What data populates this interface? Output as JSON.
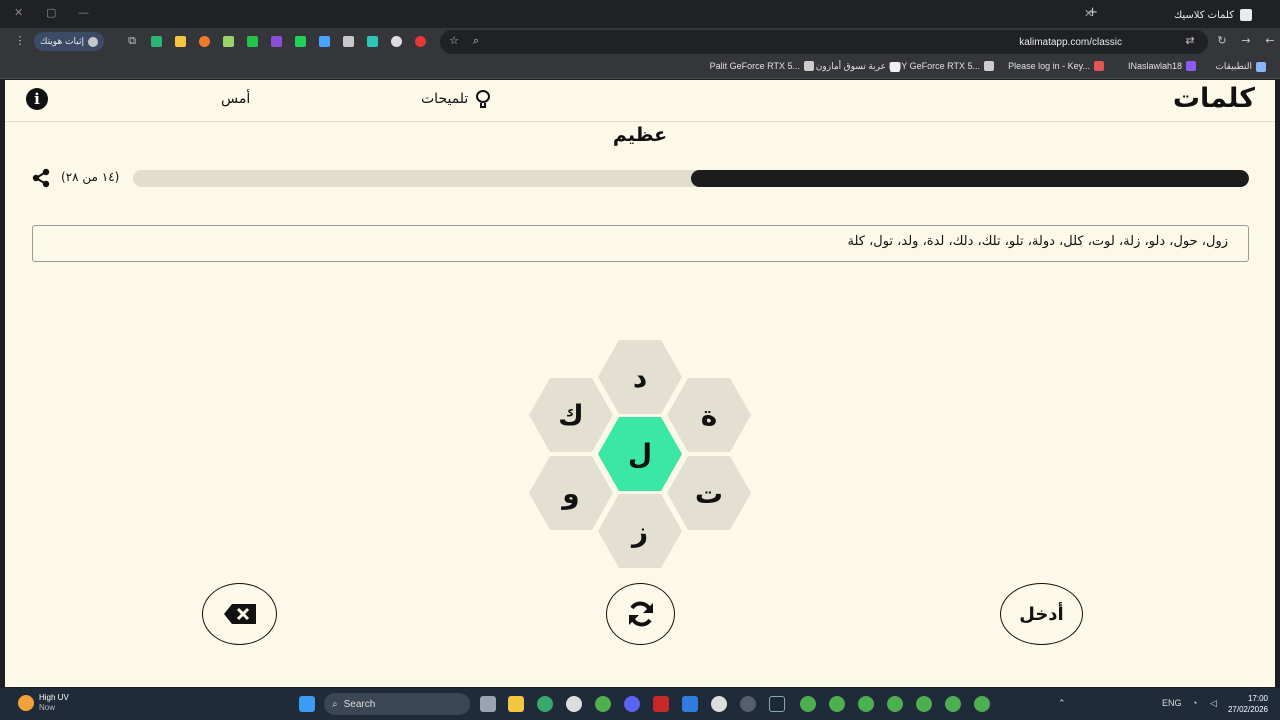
{
  "browser": {
    "tab_title": "كلمات كلاسيك",
    "url": "kalimatapp.com/classic",
    "profile_label": "إثبات هويتك",
    "bookmarks": [
      {
        "label": "التطبيقات",
        "color": "#8ab4f8"
      },
      {
        "label": "INaslawlah18",
        "color": "#8b5cf6"
      },
      {
        "label": "Please log in - Key...",
        "color": "#e25555"
      },
      {
        "label": "PNY GeForce RTX 5...",
        "color": "#cccccc"
      },
      {
        "label": "عربة تسوق أمازون",
        "color": "#f0f0f0"
      },
      {
        "label": "Palit GeForce RTX 5...",
        "color": "#cccccc"
      }
    ]
  },
  "app": {
    "logo": "كلمات",
    "hints_label": "تلميحات",
    "yesterday_label": "أمس",
    "info_icon": "i",
    "rank": "عظيم",
    "count_label": "(١٤ من ٢٨)",
    "progress": 0.5,
    "found_words": "زول، حول، دلو، زلة، لوت، كلل، دولة، تلو، تلك، دلك، لدة، ولد، تول، كلة",
    "letters": {
      "center": "ل",
      "top": "د",
      "upper_left": "ك",
      "upper_right": "ة",
      "lower_left": "و",
      "lower_right": "ت",
      "bottom": "ز"
    },
    "enter_label": "أدخل",
    "center_color": "#3ae7a5",
    "hex_color": "#e3e0d1"
  },
  "taskbar": {
    "weather_title": "High UV",
    "weather_sub": "Now",
    "search_label": "Search",
    "lang": "ENG",
    "time": "17:00",
    "date": "27/02/2026"
  }
}
